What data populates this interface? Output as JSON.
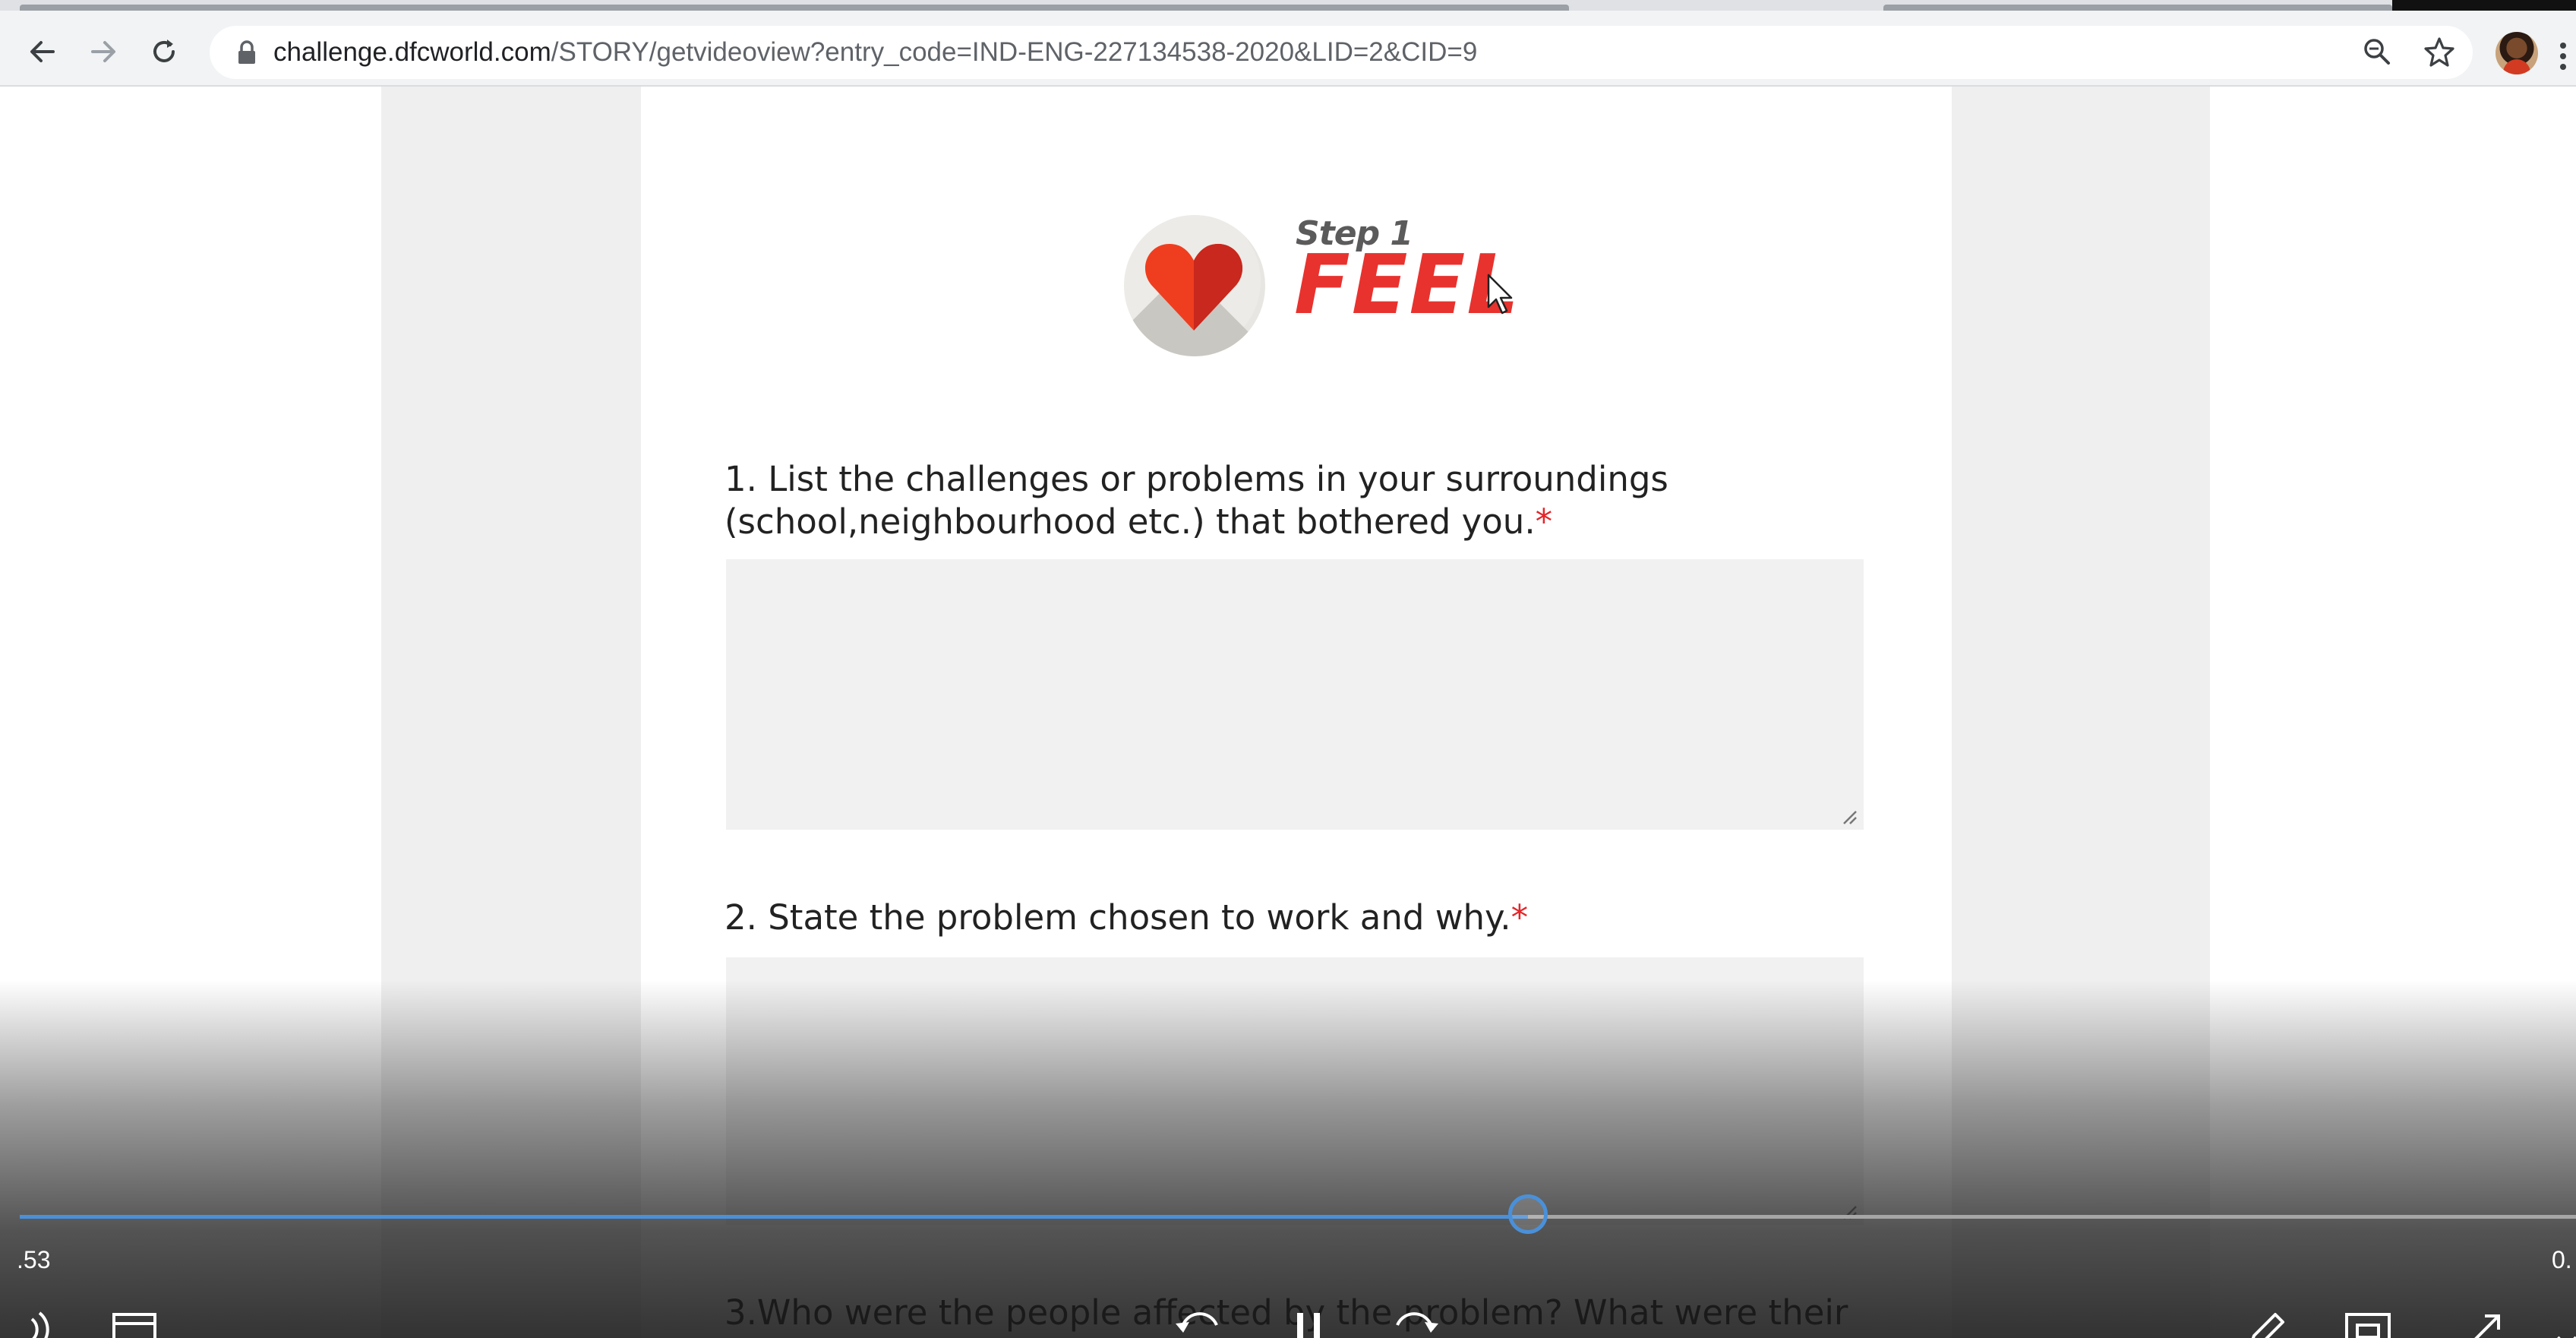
{
  "browser": {
    "url_host": "challenge.dfcworld.com",
    "url_path": "/STORY/getvideoview?entry_code=IND-ENG-227134538-2020&LID=2&CID=9",
    "icons": [
      "back-arrow-icon",
      "forward-arrow-icon",
      "reload-icon",
      "lock-icon",
      "zoom-icon",
      "star-icon",
      "profile-avatar"
    ]
  },
  "form": {
    "step": "Step 1",
    "title": "FEEL",
    "questions": [
      {
        "text": "1. List the challenges or problems in your surroundings",
        "text2": "(school,neighbourhood etc.) that bothered you.",
        "required_mark": "*"
      },
      {
        "text": "2. State the problem chosen to work and why.",
        "required_mark": "*"
      },
      {
        "text": "3.Who were the people affected by the problem? What were their"
      }
    ]
  },
  "player": {
    "elapsed": ".53",
    "remaining": "0.",
    "progress_fraction": 0.59,
    "icons": [
      "volume-icon",
      "captions-icon",
      "rewind-icon",
      "pause-icon",
      "forward-icon",
      "pen-icon",
      "pip-icon",
      "fullscreen-icon"
    ]
  },
  "colors": {
    "accent_red": "#e8322e",
    "progress_blue": "#4a90d9"
  }
}
